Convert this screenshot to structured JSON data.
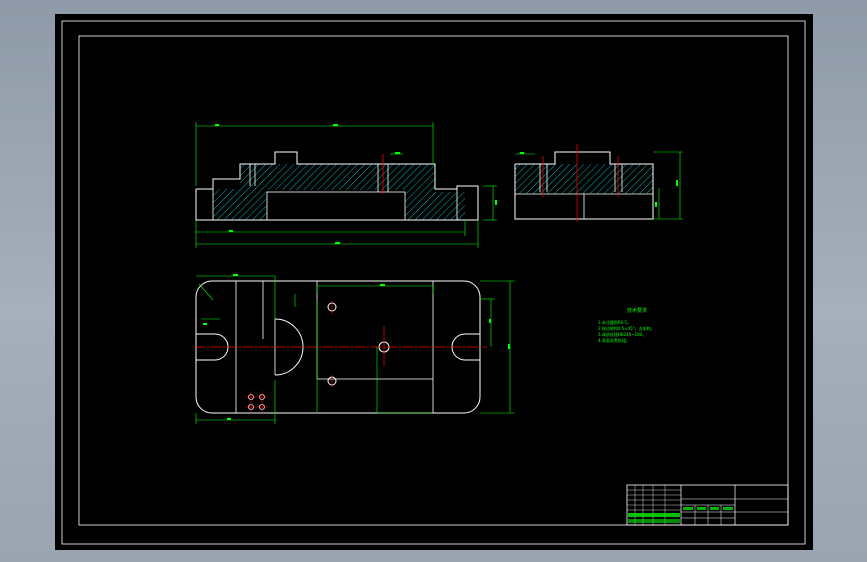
{
  "drawing": {
    "notes_title": "技术要求",
    "notes": [
      "1.未注圆角R0.5。",
      "2.锐边倒钝0.5×45°。去毛刺。",
      "3.调质处理HB240~280。",
      "4.表面发黑处理。"
    ],
    "colors": {
      "background": "#000000",
      "outline": "#ffffff",
      "dimension": "#00ff00",
      "centerline": "#ff0000",
      "hatch": "#00ffff",
      "frame_hatch": "#00ff00"
    }
  }
}
